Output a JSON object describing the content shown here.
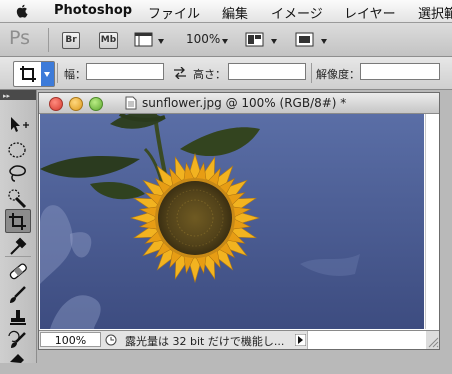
{
  "menu": {
    "app_name": "Photoshop",
    "items": [
      "ファイル",
      "編集",
      "イメージ",
      "レイヤー",
      "選択範"
    ]
  },
  "app_bar": {
    "logo": "Ps",
    "bridge_label": "Br",
    "minibridge_label": "Mb",
    "zoom": "100%"
  },
  "options_bar": {
    "width_label": "幅：",
    "height_label": "高さ：",
    "resolution_label": "解像度：",
    "width_value": "",
    "height_value": "",
    "resolution_value": ""
  },
  "document": {
    "title": "sunflower.jpg @ 100% (RGB/8#) *",
    "zoom": "100%",
    "status_text": "露光量は 32 bit だけで機能し..."
  },
  "colors": {
    "sky": "#4a5a8e",
    "petal": "#f2b320",
    "leaf": "#2e3f22",
    "close": "#e0453c",
    "minimize": "#e6a92a",
    "zoom": "#6cb33f"
  }
}
